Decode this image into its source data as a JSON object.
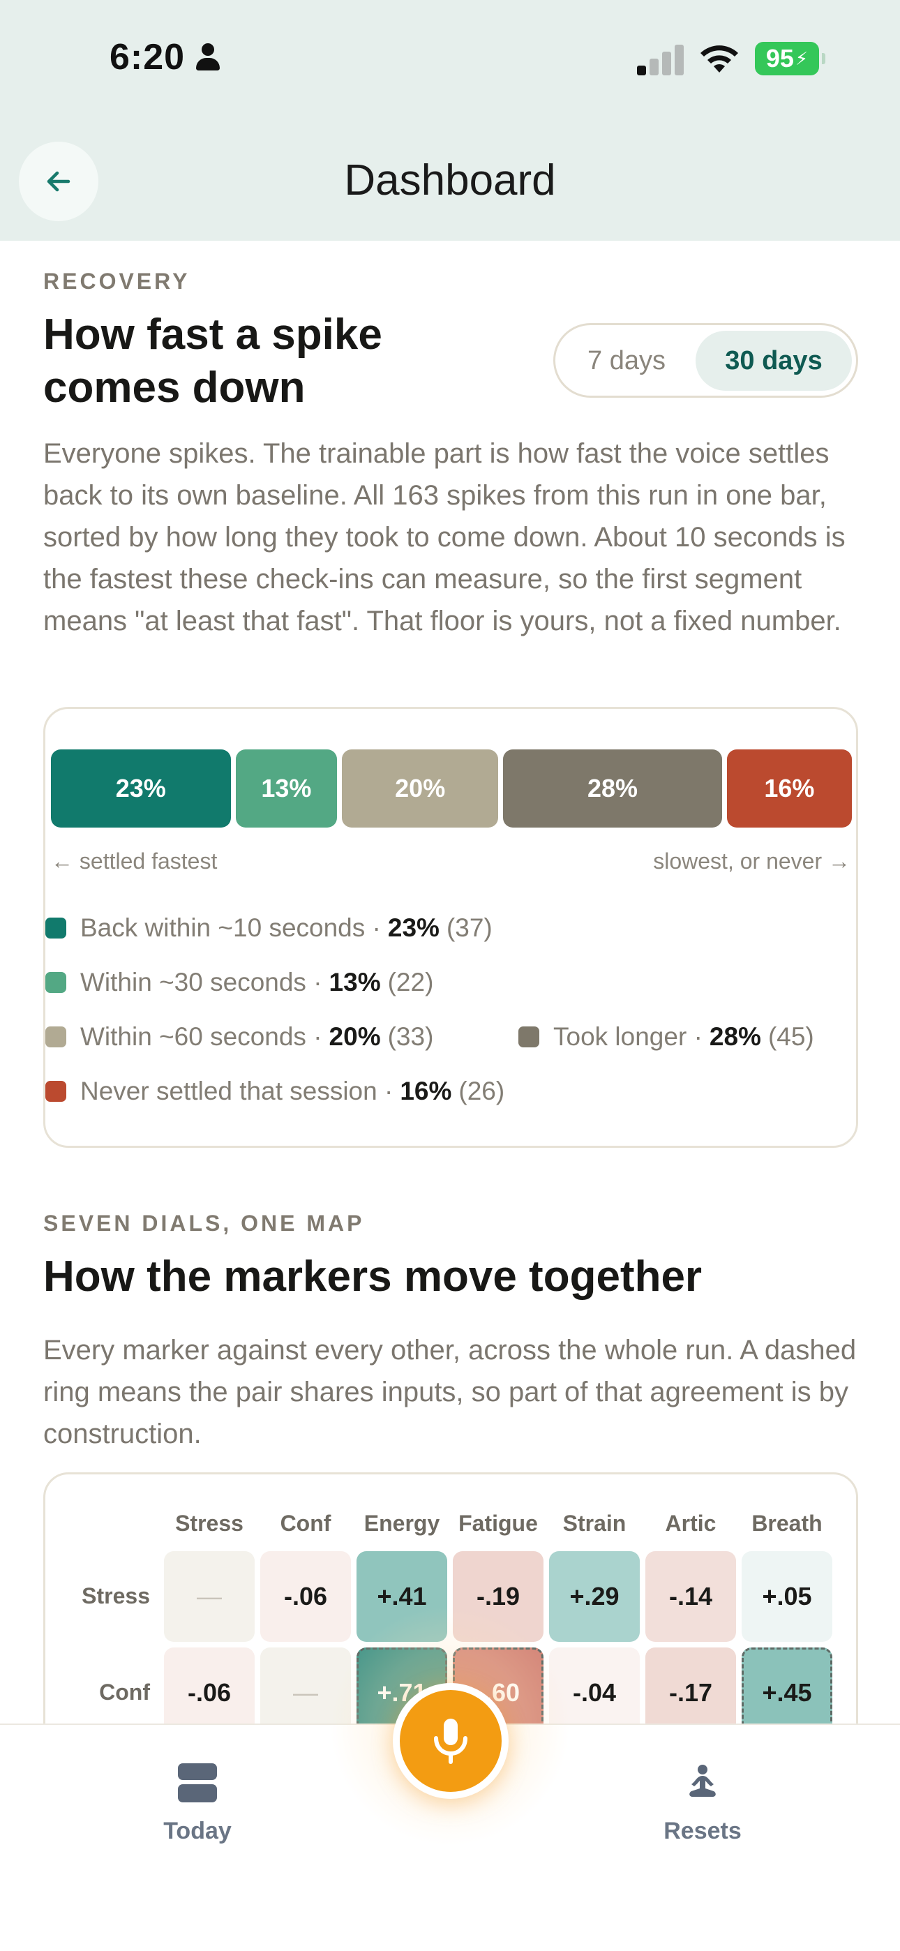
{
  "status_bar": {
    "time": "6:20",
    "battery": "95"
  },
  "header": {
    "title": "Dashboard"
  },
  "recovery": {
    "eyebrow": "RECOVERY",
    "title_line1": "How fast a spike",
    "title_line2": "comes down",
    "toggle": {
      "option_7": "7 days",
      "option_30": "30 days",
      "selected": "30 days"
    },
    "description": "Everyone spikes. The trainable part is how fast the voice settles back to its own baseline. All 163 spikes from this run in one bar, sorted by how long they took to come down. About 10 seconds is the fastest these check-ins can measure, so the first segment means \"at least that fast\". That floor is yours, not a fixed number.",
    "bar": {
      "segments": [
        {
          "label": "23%",
          "value": 23,
          "color": "#117a6c"
        },
        {
          "label": "13%",
          "value": 13,
          "color": "#53a884"
        },
        {
          "label": "20%",
          "value": 20,
          "color": "#b1aa93"
        },
        {
          "label": "28%",
          "value": 28,
          "color": "#7e786a"
        },
        {
          "label": "16%",
          "value": 16,
          "color": "#bb4a2f"
        }
      ],
      "left_label": "← settled fastest",
      "right_label": "slowest, or never →"
    },
    "legend": [
      {
        "text": "Back within ~10 seconds ·",
        "pct": "23%",
        "count": "(37)",
        "color": "#117a6c"
      },
      {
        "text": "Within ~30 seconds ·",
        "pct": "13%",
        "count": "(22)",
        "color": "#53a884"
      },
      {
        "text": "Within ~60 seconds ·",
        "pct": "20%",
        "count": "(33)",
        "color": "#b1aa93"
      },
      {
        "text": "Took longer ·",
        "pct": "28%",
        "count": "(45)",
        "color": "#7e786a"
      },
      {
        "text": "Never settled that session ·",
        "pct": "16%",
        "count": "(26)",
        "color": "#bb4a2f"
      }
    ]
  },
  "markers": {
    "eyebrow": "SEVEN DIALS, ONE MAP",
    "title": "How the markers move together",
    "description": "Every marker against every other, across the whole run. A dashed ring means the pair shares inputs, so part of that agreement is by construction.",
    "columns": [
      "Stress",
      "Conf",
      "Energy",
      "Fatigue",
      "Strain",
      "Artic",
      "Breath"
    ],
    "rows": [
      {
        "label": "Stress",
        "cells": [
          {
            "v": "—",
            "c": "#f4f2ec",
            "diag": true
          },
          {
            "v": "-.06",
            "c": "#f9efec"
          },
          {
            "v": "+.41",
            "c": "#90c5bd"
          },
          {
            "v": "-.19",
            "c": "#efd5cf"
          },
          {
            "v": "+.29",
            "c": "#aad3ce"
          },
          {
            "v": "-.14",
            "c": "#f2dfda"
          },
          {
            "v": "+.05",
            "c": "#eef5f4"
          }
        ]
      },
      {
        "label": "Conf",
        "cells": [
          {
            "v": "-.06",
            "c": "#f9efec"
          },
          {
            "v": "—",
            "c": "#f4f2ec",
            "diag": true
          },
          {
            "v": "+.71",
            "c": "#4a988b",
            "dash": true,
            "light": true
          },
          {
            "v": "-.60",
            "c": "#d4877a",
            "dash": true,
            "light": true
          },
          {
            "v": "-.04",
            "c": "#faf3f1"
          },
          {
            "v": "-.17",
            "c": "#f0dad4"
          },
          {
            "v": "+.45",
            "c": "#8bc2ba",
            "dash": true
          }
        ]
      }
    ]
  },
  "nav": {
    "today": "Today",
    "resets": "Resets"
  }
}
